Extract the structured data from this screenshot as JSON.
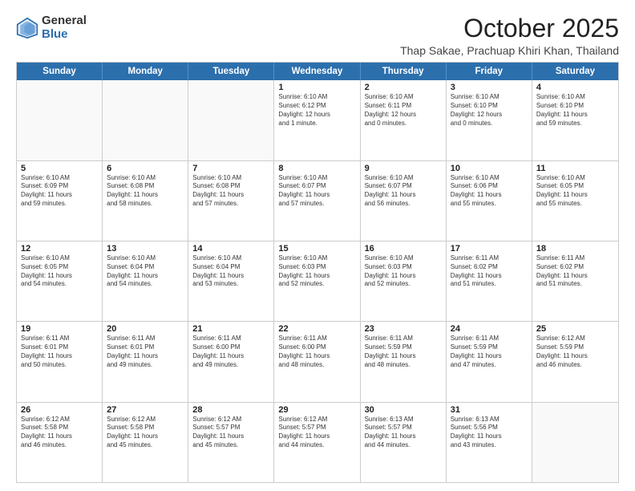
{
  "logo": {
    "general": "General",
    "blue": "Blue"
  },
  "header": {
    "month": "October 2025",
    "location": "Thap Sakae, Prachuap Khiri Khan, Thailand"
  },
  "days": [
    "Sunday",
    "Monday",
    "Tuesday",
    "Wednesday",
    "Thursday",
    "Friday",
    "Saturday"
  ],
  "weeks": [
    [
      {
        "num": "",
        "text": ""
      },
      {
        "num": "",
        "text": ""
      },
      {
        "num": "",
        "text": ""
      },
      {
        "num": "1",
        "text": "Sunrise: 6:10 AM\nSunset: 6:12 PM\nDaylight: 12 hours\nand 1 minute."
      },
      {
        "num": "2",
        "text": "Sunrise: 6:10 AM\nSunset: 6:11 PM\nDaylight: 12 hours\nand 0 minutes."
      },
      {
        "num": "3",
        "text": "Sunrise: 6:10 AM\nSunset: 6:10 PM\nDaylight: 12 hours\nand 0 minutes."
      },
      {
        "num": "4",
        "text": "Sunrise: 6:10 AM\nSunset: 6:10 PM\nDaylight: 11 hours\nand 59 minutes."
      }
    ],
    [
      {
        "num": "5",
        "text": "Sunrise: 6:10 AM\nSunset: 6:09 PM\nDaylight: 11 hours\nand 59 minutes."
      },
      {
        "num": "6",
        "text": "Sunrise: 6:10 AM\nSunset: 6:08 PM\nDaylight: 11 hours\nand 58 minutes."
      },
      {
        "num": "7",
        "text": "Sunrise: 6:10 AM\nSunset: 6:08 PM\nDaylight: 11 hours\nand 57 minutes."
      },
      {
        "num": "8",
        "text": "Sunrise: 6:10 AM\nSunset: 6:07 PM\nDaylight: 11 hours\nand 57 minutes."
      },
      {
        "num": "9",
        "text": "Sunrise: 6:10 AM\nSunset: 6:07 PM\nDaylight: 11 hours\nand 56 minutes."
      },
      {
        "num": "10",
        "text": "Sunrise: 6:10 AM\nSunset: 6:06 PM\nDaylight: 11 hours\nand 55 minutes."
      },
      {
        "num": "11",
        "text": "Sunrise: 6:10 AM\nSunset: 6:05 PM\nDaylight: 11 hours\nand 55 minutes."
      }
    ],
    [
      {
        "num": "12",
        "text": "Sunrise: 6:10 AM\nSunset: 6:05 PM\nDaylight: 11 hours\nand 54 minutes."
      },
      {
        "num": "13",
        "text": "Sunrise: 6:10 AM\nSunset: 6:04 PM\nDaylight: 11 hours\nand 54 minutes."
      },
      {
        "num": "14",
        "text": "Sunrise: 6:10 AM\nSunset: 6:04 PM\nDaylight: 11 hours\nand 53 minutes."
      },
      {
        "num": "15",
        "text": "Sunrise: 6:10 AM\nSunset: 6:03 PM\nDaylight: 11 hours\nand 52 minutes."
      },
      {
        "num": "16",
        "text": "Sunrise: 6:10 AM\nSunset: 6:03 PM\nDaylight: 11 hours\nand 52 minutes."
      },
      {
        "num": "17",
        "text": "Sunrise: 6:11 AM\nSunset: 6:02 PM\nDaylight: 11 hours\nand 51 minutes."
      },
      {
        "num": "18",
        "text": "Sunrise: 6:11 AM\nSunset: 6:02 PM\nDaylight: 11 hours\nand 51 minutes."
      }
    ],
    [
      {
        "num": "19",
        "text": "Sunrise: 6:11 AM\nSunset: 6:01 PM\nDaylight: 11 hours\nand 50 minutes."
      },
      {
        "num": "20",
        "text": "Sunrise: 6:11 AM\nSunset: 6:01 PM\nDaylight: 11 hours\nand 49 minutes."
      },
      {
        "num": "21",
        "text": "Sunrise: 6:11 AM\nSunset: 6:00 PM\nDaylight: 11 hours\nand 49 minutes."
      },
      {
        "num": "22",
        "text": "Sunrise: 6:11 AM\nSunset: 6:00 PM\nDaylight: 11 hours\nand 48 minutes."
      },
      {
        "num": "23",
        "text": "Sunrise: 6:11 AM\nSunset: 5:59 PM\nDaylight: 11 hours\nand 48 minutes."
      },
      {
        "num": "24",
        "text": "Sunrise: 6:11 AM\nSunset: 5:59 PM\nDaylight: 11 hours\nand 47 minutes."
      },
      {
        "num": "25",
        "text": "Sunrise: 6:12 AM\nSunset: 5:59 PM\nDaylight: 11 hours\nand 46 minutes."
      }
    ],
    [
      {
        "num": "26",
        "text": "Sunrise: 6:12 AM\nSunset: 5:58 PM\nDaylight: 11 hours\nand 46 minutes."
      },
      {
        "num": "27",
        "text": "Sunrise: 6:12 AM\nSunset: 5:58 PM\nDaylight: 11 hours\nand 45 minutes."
      },
      {
        "num": "28",
        "text": "Sunrise: 6:12 AM\nSunset: 5:57 PM\nDaylight: 11 hours\nand 45 minutes."
      },
      {
        "num": "29",
        "text": "Sunrise: 6:12 AM\nSunset: 5:57 PM\nDaylight: 11 hours\nand 44 minutes."
      },
      {
        "num": "30",
        "text": "Sunrise: 6:13 AM\nSunset: 5:57 PM\nDaylight: 11 hours\nand 44 minutes."
      },
      {
        "num": "31",
        "text": "Sunrise: 6:13 AM\nSunset: 5:56 PM\nDaylight: 11 hours\nand 43 minutes."
      },
      {
        "num": "",
        "text": ""
      }
    ]
  ]
}
